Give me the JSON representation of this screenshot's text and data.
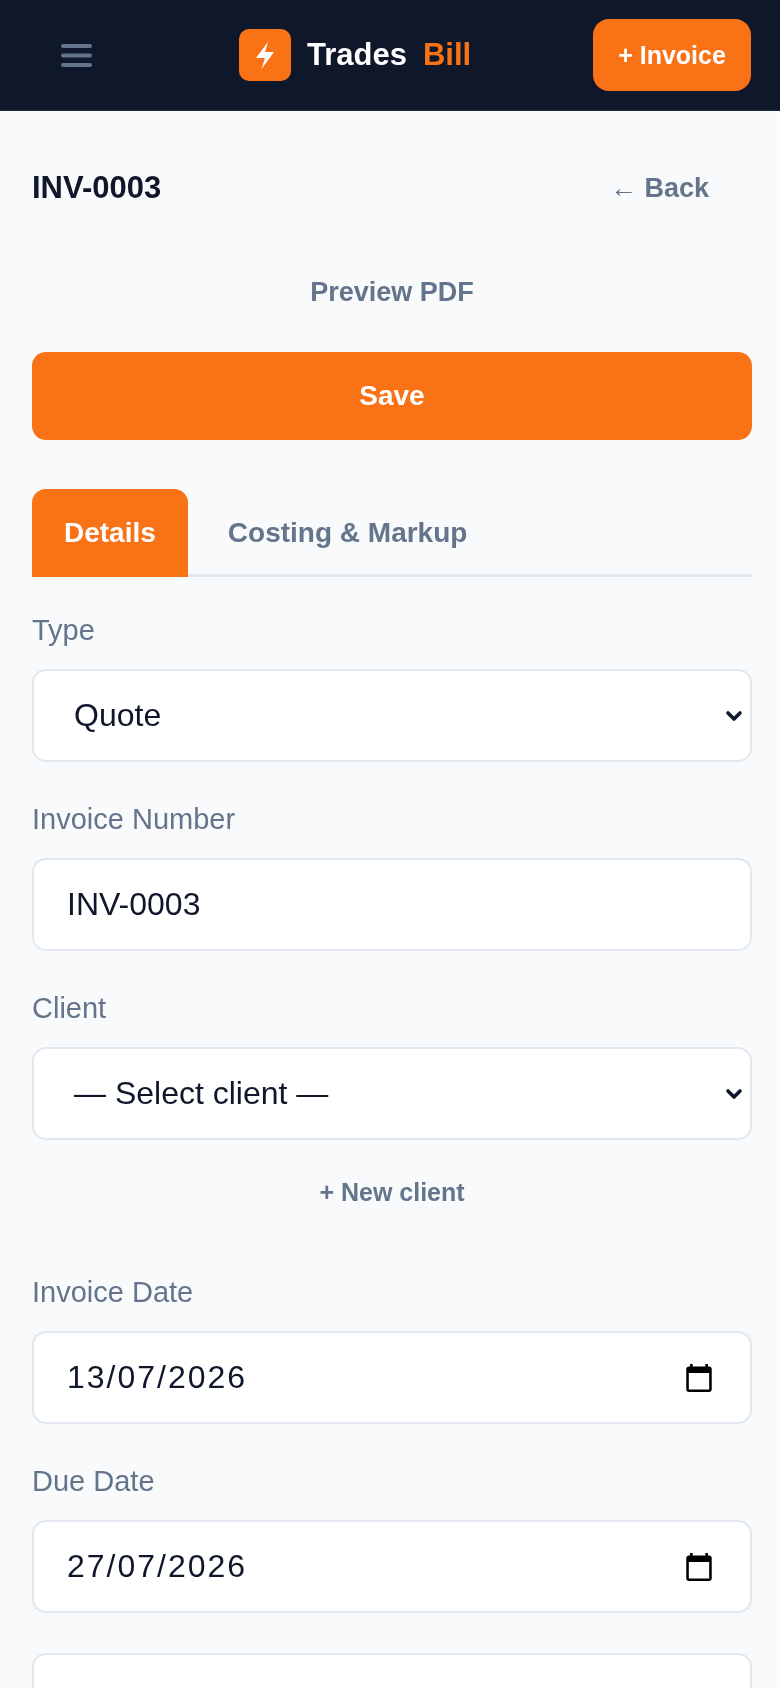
{
  "header": {
    "brand": {
      "name": "Trades",
      "accent": "Bill"
    },
    "new_invoice_button": "+ Invoice"
  },
  "page": {
    "title": "INV-0003",
    "back_link": "← Back",
    "preview_link": "Preview PDF",
    "save_button": "Save"
  },
  "tabs": [
    {
      "label": "Details",
      "selected": true
    },
    {
      "label": "Costing & Markup",
      "selected": false
    }
  ],
  "form": {
    "fields": [
      {
        "kind": "select",
        "label": "Type",
        "value": "Quote"
      },
      {
        "kind": "text",
        "label": "Invoice Number",
        "value": "INV-0003"
      },
      {
        "kind": "select",
        "label": "Client",
        "value": "— Select client —",
        "action": "+ New client"
      },
      {
        "kind": "date",
        "label": "Invoice Date",
        "value": "13/07/2026"
      },
      {
        "kind": "date",
        "label": "Due Date",
        "value": "27/07/2026"
      },
      {
        "kind": "text"
      }
    ]
  }
}
